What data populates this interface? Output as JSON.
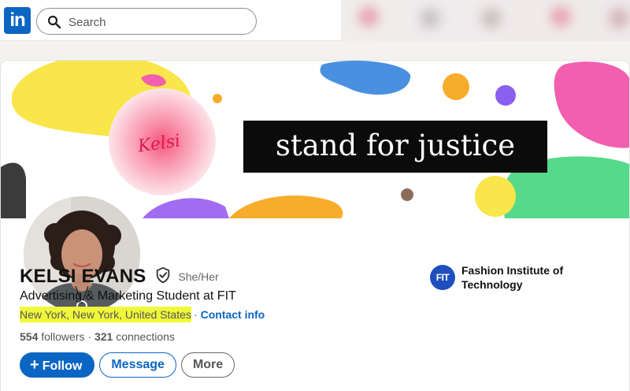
{
  "nav": {
    "logo_text": "in",
    "search_placeholder": "Search",
    "brand_color": "#0a66c2"
  },
  "banner": {
    "tagline": "stand for justice",
    "signature": "Kelsi"
  },
  "profile": {
    "name": "KELSI EVANS",
    "verified_icon": "shield-check-icon",
    "pronouns": "She/Her",
    "headline": "Advertising & Marketing Student at FIT",
    "location": "New York, New York, United States",
    "location_separator": "·",
    "contact_label": "Contact info",
    "followers_count": "554",
    "followers_label": "followers",
    "stats_separator": "·",
    "connections_count": "321",
    "connections_label": "connections"
  },
  "actions": {
    "follow_label": "Follow",
    "message_label": "Message",
    "more_label": "More"
  },
  "organization": {
    "logo_text": "FIT",
    "name": "Fashion Institute of Technology"
  }
}
